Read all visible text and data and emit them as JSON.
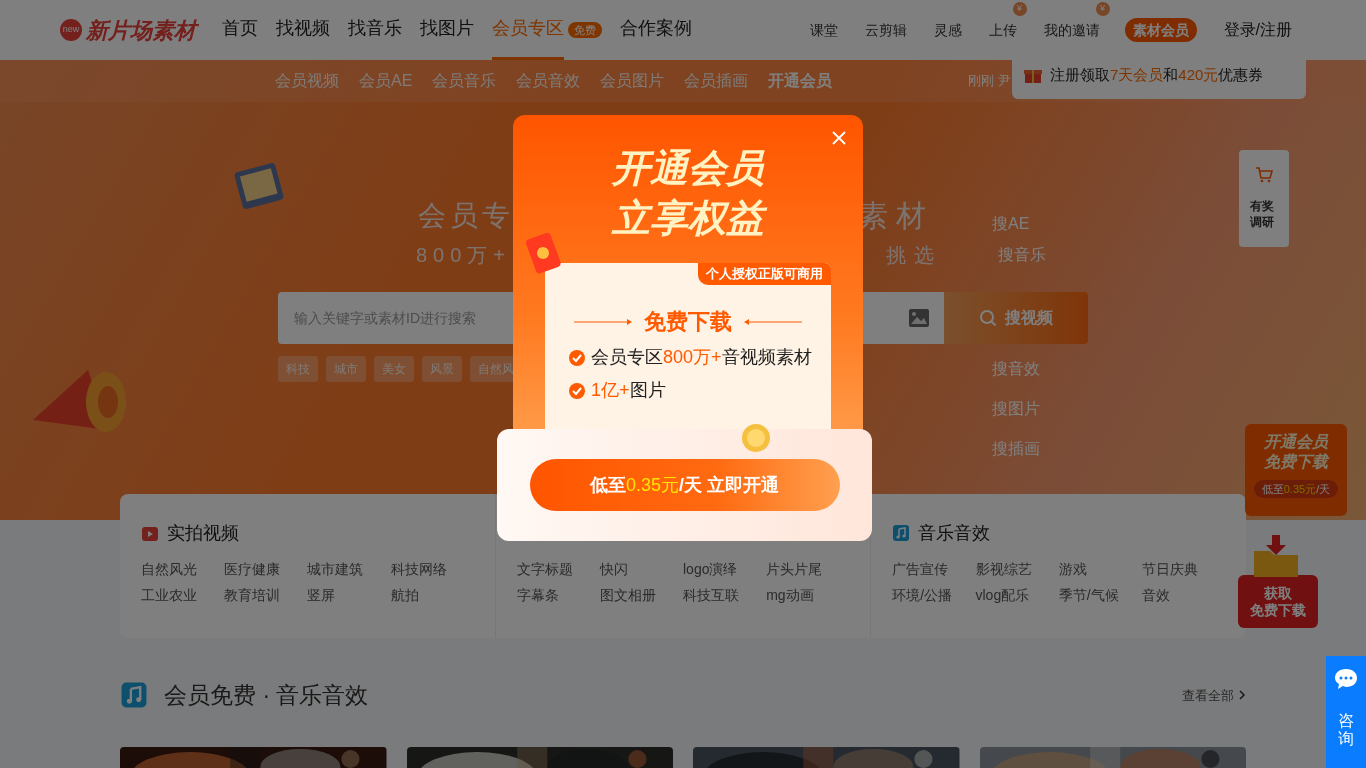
{
  "header": {
    "logo_badge": "new",
    "logo": "新片场素材",
    "nav": [
      {
        "label": "首页",
        "selected": false
      },
      {
        "label": "找视频",
        "selected": false
      },
      {
        "label": "找音乐",
        "selected": false
      },
      {
        "label": "找图片",
        "selected": false
      },
      {
        "label": "会员专区",
        "selected": true,
        "badge": "免费"
      },
      {
        "label": "合作案例",
        "selected": false
      }
    ],
    "links": [
      {
        "label": "课堂"
      },
      {
        "label": "云剪辑"
      },
      {
        "label": "灵感"
      },
      {
        "label": "上传",
        "badge": "¥"
      },
      {
        "label": "我的邀请",
        "badge": "¥"
      }
    ],
    "vip_button": "素材会员",
    "login": "登录/注册"
  },
  "subnav": {
    "items": [
      {
        "label": "会员视频",
        "selected": false
      },
      {
        "label": "会员AE",
        "selected": false
      },
      {
        "label": "会员音乐",
        "selected": false
      },
      {
        "label": "会员音效",
        "selected": false
      },
      {
        "label": "会员图片",
        "selected": false
      },
      {
        "label": "会员插画",
        "selected": false
      },
      {
        "label": "开通会员",
        "selected": true
      }
    ],
    "ticker": "刚刚 尹"
  },
  "tooltip": {
    "parts": [
      {
        "text": "注册领取",
        "highlight": false
      },
      {
        "text": "7天会员",
        "highlight": true
      },
      {
        "text": "和",
        "highlight": false
      },
      {
        "text": "420元",
        "highlight": true
      },
      {
        "text": "优惠券",
        "highlight": false
      }
    ]
  },
  "hero": {
    "headline_parts": [
      "会员专",
      "素材"
    ],
    "subtitle_parts": [
      "800万+",
      "挑选"
    ],
    "search": {
      "placeholder": "输入关键字或素材ID进行搜索",
      "button": "搜视频"
    },
    "types_above": [
      "搜AE",
      "搜音乐"
    ],
    "types_below": [
      "搜音效",
      "搜图片",
      "搜插画"
    ],
    "tags": [
      "科技",
      "城市",
      "美女",
      "风景",
      "自然风"
    ]
  },
  "categories": [
    {
      "title": "实拍视频",
      "kind": "video",
      "items": [
        "自然风光",
        "医疗健康",
        "城市建筑",
        "科技网络",
        "工业农业",
        "教育培训",
        "竖屏",
        "航拍"
      ]
    },
    {
      "items": [
        "文字标题",
        "快闪",
        "logo演绎",
        "片头片尾",
        "字幕条",
        "图文相册",
        "科技互联",
        "mg动画"
      ]
    },
    {
      "title": "音乐音效",
      "kind": "music",
      "items": [
        "广告宣传",
        "影视综艺",
        "游戏",
        "节日庆典",
        "环境/公播",
        "vlog配乐",
        "季节/气候",
        "音效"
      ]
    }
  ],
  "section": {
    "title": "会员免费 · 音乐音效",
    "more": "查看全部"
  },
  "survey": {
    "label": "有奖调研"
  },
  "promo": {
    "title_lines": [
      "开通会员",
      "免费下载"
    ],
    "price_parts": [
      {
        "text": "低至",
        "highlight": false
      },
      {
        "text": "0.35元",
        "highlight": true
      },
      {
        "text": "/天",
        "highlight": false
      }
    ]
  },
  "download_promo": {
    "label_lines": [
      "获取",
      "免费下载"
    ]
  },
  "consult": {
    "label": "咨询"
  },
  "modal": {
    "title_lines": [
      "开通会员",
      "立享权益"
    ],
    "ribbon": "个人授权正版可商用",
    "heading": "免费下载",
    "benefits": [
      {
        "parts": [
          {
            "text": "会员专区",
            "highlight": false
          },
          {
            "text": "800万+",
            "highlight": true
          },
          {
            "text": "音视频素材",
            "highlight": false
          }
        ]
      },
      {
        "parts": [
          {
            "text": "1亿+",
            "highlight": true
          },
          {
            "text": "图片",
            "highlight": false
          }
        ]
      }
    ],
    "button_parts": [
      {
        "text": "低至",
        "highlight": false
      },
      {
        "text": "0.35元",
        "highlight": true
      },
      {
        "text": "/天 立即开通",
        "highlight": false
      }
    ]
  }
}
